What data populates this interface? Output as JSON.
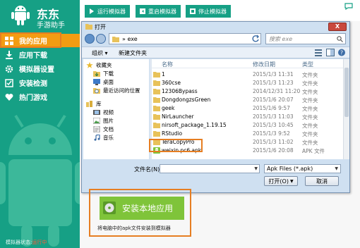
{
  "app": {
    "name": "东东",
    "subtitle": "手游助手"
  },
  "sidebar": {
    "items": [
      {
        "label": "我的应用",
        "icon": "apps-grid-icon",
        "active": true
      },
      {
        "label": "应用下载",
        "icon": "download-icon",
        "active": false
      },
      {
        "label": "模拟器设置",
        "icon": "gear-icon",
        "active": false
      },
      {
        "label": "安装检测",
        "icon": "checkbox-icon",
        "active": false
      },
      {
        "label": "热门游戏",
        "icon": "heart-icon",
        "active": false
      }
    ],
    "status_label": "模拟器状态:",
    "status_value": "运行中"
  },
  "toolbar": {
    "run_label": "运行模拟器",
    "restart_label": "重启模拟器",
    "stop_label": "停止模拟器"
  },
  "dialog": {
    "title": "打开",
    "close_label": "X",
    "address_path": "exe",
    "search_placeholder": "搜索 exe",
    "organize_label": "组织 ▾",
    "new_folder_label": "新建文件夹",
    "tree": {
      "favorites_label": "收藏夹",
      "favorites": [
        "下载",
        "桌面",
        "最近访问的位置"
      ],
      "library_label": "库",
      "library": [
        "视频",
        "图片",
        "文档",
        "音乐"
      ]
    },
    "columns": {
      "name": "名称",
      "date": "修改日期",
      "type": "类型"
    },
    "files": [
      {
        "name": "1",
        "date": "2015/1/3 11:31",
        "type": "文件夹",
        "icon": "folder-icon"
      },
      {
        "name": "360cse",
        "date": "2015/1/3 11:23",
        "type": "文件夹",
        "icon": "folder-icon"
      },
      {
        "name": "12306Bypass",
        "date": "2014/12/31 11:20",
        "type": "文件夹",
        "icon": "folder-icon"
      },
      {
        "name": "DongdongzsGreen",
        "date": "2015/1/6 20:07",
        "type": "文件夹",
        "icon": "folder-icon"
      },
      {
        "name": "geek",
        "date": "2015/1/6 9:57",
        "type": "文件夹",
        "icon": "folder-icon"
      },
      {
        "name": "NirLauncher",
        "date": "2015/1/3 11:03",
        "type": "文件夹",
        "icon": "folder-icon"
      },
      {
        "name": "nirsoft_package_1.19.15",
        "date": "2015/1/3 10:45",
        "type": "文件夹",
        "icon": "folder-icon"
      },
      {
        "name": "RStudio",
        "date": "2015/1/3 9:52",
        "type": "文件夹",
        "icon": "folder-icon"
      },
      {
        "name": "TeraCopyPro",
        "date": "2015/1/3 11:02",
        "type": "文件夹",
        "icon": "folder-icon"
      },
      {
        "name": "weixin.pc6.apk",
        "date": "2015/1/6 20:08",
        "type": "APK 文件",
        "icon": "apk-file-icon"
      }
    ],
    "filename_label": "文件名(N):",
    "filename_value": "",
    "filetype_value": "Apk Files (*.apk)",
    "open_label": "打开(O)",
    "cancel_label": "取消"
  },
  "install": {
    "button_label": "安装本地应用",
    "caption": "将电脑中的apk文件安装到模拟器"
  },
  "colors": {
    "primary": "#16a085",
    "accent": "#f39c12",
    "highlight": "#e67e22",
    "install": "#7fc43a"
  }
}
